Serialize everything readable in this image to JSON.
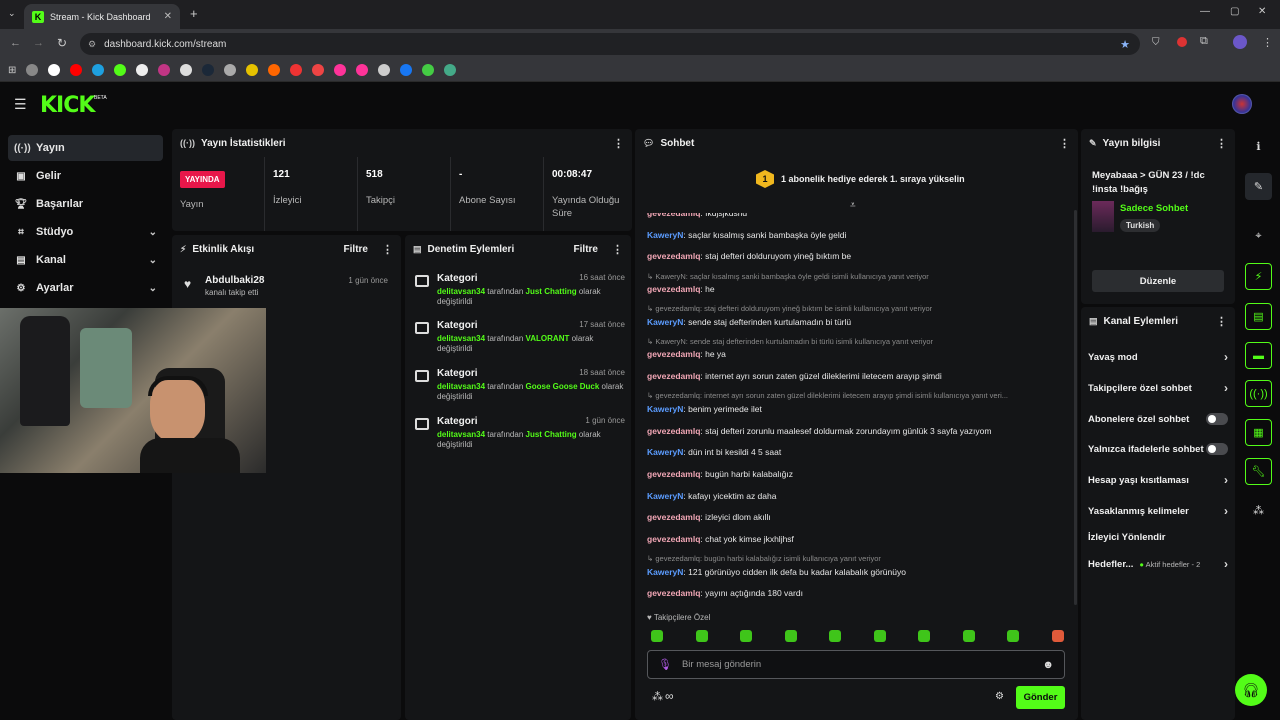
{
  "browser": {
    "tab_title": "Stream - Kick Dashboard",
    "url": "dashboard.kick.com/stream"
  },
  "header": {
    "logo": "KICK",
    "beta": "BETA"
  },
  "sidebar": {
    "items": [
      {
        "label": "Yayın",
        "icon": "broadcast-icon"
      },
      {
        "label": "Gelir",
        "icon": "revenue-icon"
      },
      {
        "label": "Başarılar",
        "icon": "trophy-icon"
      },
      {
        "label": "Stüdyo",
        "icon": "studio-icon"
      },
      {
        "label": "Kanal",
        "icon": "channel-icon"
      },
      {
        "label": "Ayarlar",
        "icon": "gear-icon"
      }
    ]
  },
  "stats": {
    "title": "Yayın İstatistikleri",
    "live_badge": "YAYINDA",
    "live_label": "Yayın",
    "viewers": "121",
    "viewers_label": "İzleyici",
    "followers": "518",
    "followers_label": "Takipçi",
    "subs": "-",
    "subs_label": "Abone Sayısı",
    "duration": "00:08:47",
    "duration_label": "Yayında Olduğu Süre"
  },
  "activity": {
    "title": "Etkinlik Akışı",
    "filter": "Filtre",
    "items": [
      {
        "user": "Abdulbaki28",
        "text": "kanalı takip etti",
        "time": "1 gün önce"
      }
    ]
  },
  "moderation": {
    "title": "Denetim Eylemleri",
    "filter": "Filtre",
    "items": [
      {
        "heading": "Kategori",
        "time": "16 saat önce",
        "user": "delitavsan34",
        "mid": " tarafından ",
        "cat": "Just Chatting",
        "tail": " olarak değiştirildi"
      },
      {
        "heading": "Kategori",
        "time": "17 saat önce",
        "user": "delitavsan34",
        "mid": " tarafından ",
        "cat": "VALORANT",
        "tail": " olarak değiştirildi"
      },
      {
        "heading": "Kategori",
        "time": "18 saat önce",
        "user": "delitavsan34",
        "mid": " tarafından ",
        "cat": "Goose Goose Duck",
        "tail": " olarak değiştirildi"
      },
      {
        "heading": "Kategori",
        "time": "1 gün önce",
        "user": "delitavsan34",
        "mid": " tarafından ",
        "cat": "Just Chatting",
        "tail": " olarak değiştirildi"
      }
    ]
  },
  "chat": {
    "title": "Sohbet",
    "pinned": "1 abonelik hediye ederek 1. sıraya yükselin",
    "pinned_rank": "1",
    "messages": [
      {
        "type": "msg",
        "user": "gevezedamlq",
        "text": ": ıkdjsjkdsnd",
        "cls": "u1"
      },
      {
        "type": "msg",
        "user": "KaweryN",
        "text": ": saçlar kısalmış sanki bambaşka öyle geldi",
        "cls": "u2"
      },
      {
        "type": "msg",
        "user": "gevezedamlq",
        "text": ": staj defteri dolduruyom yineğ bıktım be",
        "cls": "u1"
      },
      {
        "type": "reply",
        "text": "↳ KaweryN: saçlar kısalmış sanki bambaşka öyle geldi isimli kullanıcıya yanıt veriyor"
      },
      {
        "type": "msg",
        "user": "gevezedamlq",
        "text": ": he",
        "cls": "u1"
      },
      {
        "type": "reply",
        "text": "↳ gevezedamlq: staj defteri dolduruyom yineğ bıktım be isimli kullanıcıya yanıt veriyor"
      },
      {
        "type": "msg",
        "user": "KaweryN",
        "text": ": sende staj defterinden kurtulamadın bi türlü",
        "cls": "u2"
      },
      {
        "type": "reply",
        "text": "↳ KaweryN: sende staj defterinden kurtulamadın bi türlü isimli kullanıcıya yanıt veriyor"
      },
      {
        "type": "msg",
        "user": "gevezedamlq",
        "text": ": he ya",
        "cls": "u1"
      },
      {
        "type": "msg",
        "user": "gevezedamlq",
        "text": ": internet ayrı sorun zaten güzel dileklerimi iletecem arayıp şimdi",
        "cls": "u1"
      },
      {
        "type": "reply",
        "text": "↳ gevezedamlq: internet ayrı sorun zaten güzel dileklerimi iletecem arayıp şimdi isimli kullanıcıya yanıt veri..."
      },
      {
        "type": "msg",
        "user": "KaweryN",
        "text": ": benim yerimede ilet",
        "cls": "u2"
      },
      {
        "type": "msg",
        "user": "gevezedamlq",
        "text": ": staj defteri zorunlu maalesef doldurmak zorundayım günlük 3 sayfa yazıyom",
        "cls": "u1"
      },
      {
        "type": "msg",
        "user": "KaweryN",
        "text": ": dün int bi kesildi 4 5 saat",
        "cls": "u2"
      },
      {
        "type": "msg",
        "user": "gevezedamlq",
        "text": ": bugün harbi kalabalığız",
        "cls": "u1"
      },
      {
        "type": "msg",
        "user": "KaweryN",
        "text": ": kafayı yicektim az daha",
        "cls": "u2"
      },
      {
        "type": "msg",
        "user": "gevezedamlq",
        "text": ": izleyici dlom akıllı",
        "cls": "u1"
      },
      {
        "type": "msg",
        "user": "gevezedamlq",
        "text": ": chat yok kimse jkxhljhsf",
        "cls": "u1"
      },
      {
        "type": "reply",
        "text": "↳ gevezedamlq: bugün harbi kalabalığız isimli kullanıcıya yanıt veriyor"
      },
      {
        "type": "msg",
        "user": "KaweryN",
        "text": ": 121 görünüyo cidden ilk defa bu kadar kalabalık görünüyo",
        "cls": "u2"
      },
      {
        "type": "msg",
        "user": "gevezedamlq",
        "text": ": yayını açtığında 180 vardı",
        "cls": "u1"
      }
    ],
    "followers_only": "♥ Takipçilere Özel",
    "input_placeholder": "Bir mesaj gönderin",
    "send": "Gönder"
  },
  "stream_info": {
    "title": "Yayın bilgisi",
    "stream_title": "Meyabaaa > GÜN 23 / !dc !insta !bağış",
    "category": "Sadece Sohbet",
    "language": "Turkish",
    "edit": "Düzenle"
  },
  "channel_actions": {
    "title": "Kanal Eylemleri",
    "items": [
      {
        "label": "Yavaş mod",
        "kind": "chev"
      },
      {
        "label": "Takipçilere özel sohbet",
        "kind": "chev"
      },
      {
        "label": "Abonelere özel sohbet",
        "kind": "toggle"
      },
      {
        "label": "Yalnızca ifadelerle sohbet",
        "kind": "toggle"
      },
      {
        "label": "Hesap yaşı kısıtlaması",
        "kind": "chev"
      },
      {
        "label": "Yasaklanmış kelimeler",
        "kind": "chev"
      },
      {
        "label": "İzleyici Yönlendir",
        "kind": "none"
      },
      {
        "label": "Hedefler...",
        "kind": "chev",
        "extra": "Aktif hedefler - 2"
      }
    ]
  },
  "colors": {
    "accent": "#53fc18",
    "live": "#e8174a"
  }
}
